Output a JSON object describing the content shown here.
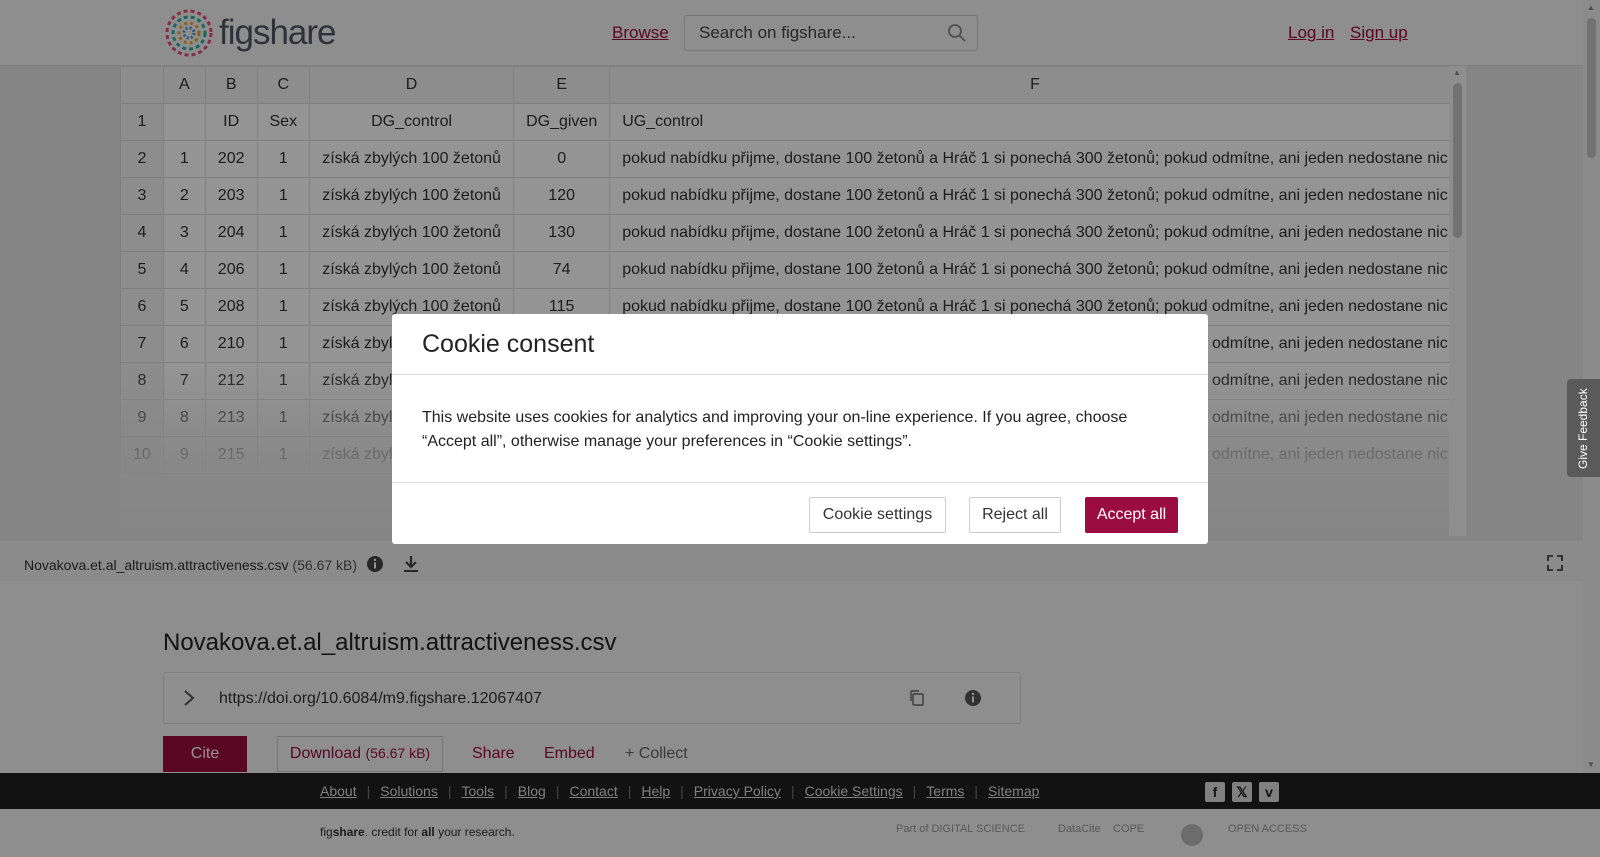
{
  "header": {
    "logo_text": "figshare",
    "browse_label": "Browse",
    "search_placeholder": "Search on figshare...",
    "login_label": "Log in",
    "signup_label": "Sign up"
  },
  "sheet": {
    "col_headers": [
      "",
      "A",
      "B",
      "C",
      "D",
      "E",
      "F"
    ],
    "rows": [
      [
        "1",
        "",
        "ID",
        "Sex",
        "DG_control",
        "DG_given",
        "UG_control"
      ],
      [
        "2",
        "1",
        "202",
        "1",
        "získá zbylých 100 žetonů",
        "0",
        "pokud nabídku přijme, dostane 100 žetonů a Hráč 1 si ponechá 300 žetonů; pokud odmítne, ani jeden nedostane nic"
      ],
      [
        "3",
        "2",
        "203",
        "1",
        "získá zbylých 100 žetonů",
        "120",
        "pokud nabídku přijme, dostane 100 žetonů a Hráč 1 si ponechá 300 žetonů; pokud odmítne, ani jeden nedostane nic"
      ],
      [
        "4",
        "3",
        "204",
        "1",
        "získá zbylých 100 žetonů",
        "130",
        "pokud nabídku přijme, dostane 100 žetonů a Hráč 1 si ponechá 300 žetonů; pokud odmítne, ani jeden nedostane nic"
      ],
      [
        "5",
        "4",
        "206",
        "1",
        "získá zbylých 100 žetonů",
        "74",
        "pokud nabídku přijme, dostane 100 žetonů a Hráč 1 si ponechá 300 žetonů; pokud odmítne, ani jeden nedostane nic"
      ],
      [
        "6",
        "5",
        "208",
        "1",
        "získá zbylých 100 žetonů",
        "115",
        "pokud nabídku přijme, dostane 100 žetonů a Hráč 1 si ponechá 300 žetonů; pokud odmítne, ani jeden nedostane nic"
      ],
      [
        "7",
        "6",
        "210",
        "1",
        "získá zbylých 100 žetonů",
        "",
        "pokud nabídku přijme, dostane 100 žetonů a Hráč 1 si ponechá 300 žetonů; pokud odmítne, ani jeden nedostane nic"
      ],
      [
        "8",
        "7",
        "212",
        "1",
        "získá zbylých 100 žetonů",
        "",
        "pokud nabídku přijme, dostane 100 žetonů a Hráč 1 si ponechá 300 žetonů; pokud odmítne, ani jeden nedostane nic"
      ],
      [
        "9",
        "8",
        "213",
        "1",
        "získá zbylých 100 žetonů",
        "",
        "pokud nabídku přijme, dostane 100 žetonů a Hráč 1 si ponechá 300 žetonů; pokud odmítne, ani jeden nedostane nic"
      ],
      [
        "10",
        "9",
        "215",
        "1",
        "získá zbylých 100 žetonů",
        "",
        "pokud nabídku přijme, dostane 100 žetonů a Hráč 1 si ponechá 300 žetonů; pokud odmítne, ani jeden nedostane nic"
      ]
    ]
  },
  "file_bar": {
    "file_name": "Novakova.et.al_altruism.attractiveness.csv",
    "file_size": "(56.67 kB)"
  },
  "item": {
    "title": "Novakova.et.al_altruism.attractiveness.csv",
    "doi": "https://doi.org/10.6084/m9.figshare.12067407",
    "cite_label": "Cite",
    "download_label": "Download",
    "download_size": "(56.67 kB)",
    "share_label": "Share",
    "embed_label": "Embed",
    "collect_label": "+ Collect"
  },
  "modal": {
    "title": "Cookie consent",
    "body": "This website uses cookies for analytics and improving your on-line experience. If you agree, choose “Accept all”, otherwise manage your preferences in “Cookie settings”.",
    "settings_label": "Cookie settings",
    "reject_label": "Reject all",
    "accept_label": "Accept all"
  },
  "feedback_label": "Give Feedback",
  "footer": {
    "links": [
      "About",
      "Solutions",
      "Tools",
      "Blog",
      "Contact",
      "Help",
      "Privacy Policy",
      "Cookie Settings",
      "Terms",
      "Sitemap"
    ],
    "tagline_prefix": "fig",
    "tagline_brand": "share",
    "tagline_mid": ". credit for ",
    "tagline_all": "all",
    "tagline_end": " your research.",
    "partners": [
      "Part of DIGITAL SCIENCE",
      "DataCite",
      "COPE",
      "",
      "OPEN ACCESS"
    ],
    "social": [
      {
        "icon": "facebook-icon",
        "glyph": "f"
      },
      {
        "icon": "x-icon",
        "glyph": "𝕏"
      },
      {
        "icon": "vimeo-icon",
        "glyph": "v"
      }
    ]
  },
  "colors": {
    "brand": "#9b0d3f",
    "footer_bg": "#1f1f1f"
  }
}
